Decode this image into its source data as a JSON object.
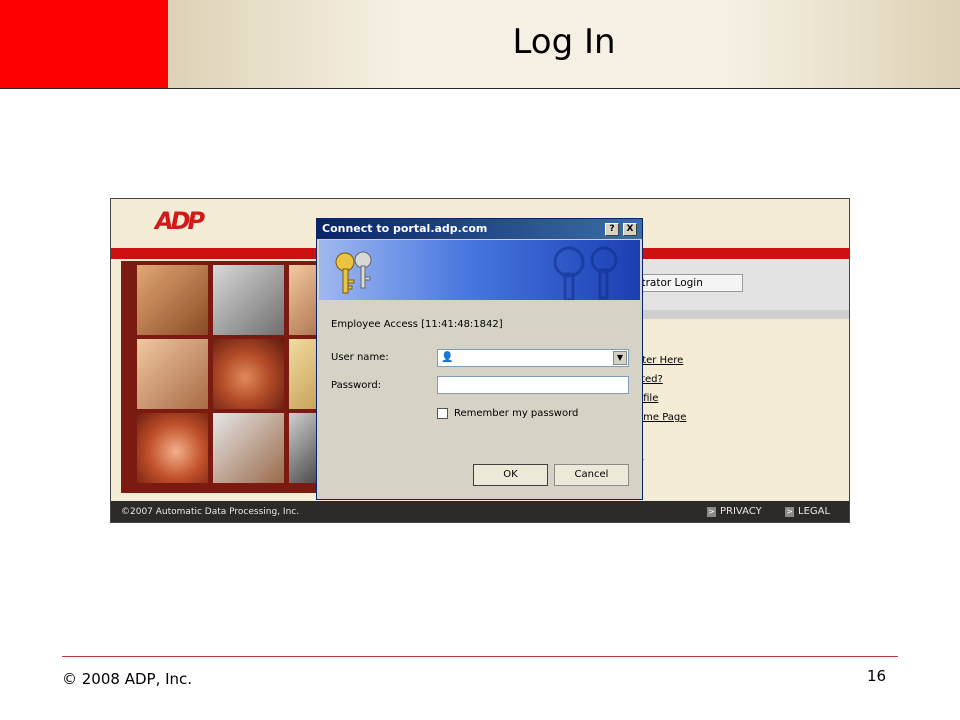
{
  "slide": {
    "title": "Log In",
    "footer": "© 2008 ADP, Inc.",
    "page_number": "16",
    "colors": {
      "accent_red": "#ff0000",
      "header_band": "#f6f1e4",
      "footer_line": "#b23a3a"
    }
  },
  "portal": {
    "logo_text": "ADP",
    "admin_button_label": "strator Login",
    "links": [
      "ster Here",
      "rted?",
      "ofile",
      "ome Page",
      "d"
    ],
    "copyright": "©2007 Automatic Data Processing, Inc.",
    "footer_links": [
      "PRIVACY",
      "LEGAL"
    ],
    "colors": {
      "background": "#f4ecd5",
      "brand_red": "#cc1111"
    }
  },
  "dialog": {
    "title": "Connect to portal.adp.com",
    "help_button": "?",
    "close_button": "X",
    "realm": "Employee Access [11:41:48:1842]",
    "username_label": "User name:",
    "username_value": "",
    "password_label": "Password:",
    "remember_label": "Remember my password",
    "remember_checked": false,
    "ok_label": "OK",
    "cancel_label": "Cancel",
    "icons": [
      "keys-icon",
      "user-icon",
      "dropdown-arrow-icon"
    ]
  }
}
